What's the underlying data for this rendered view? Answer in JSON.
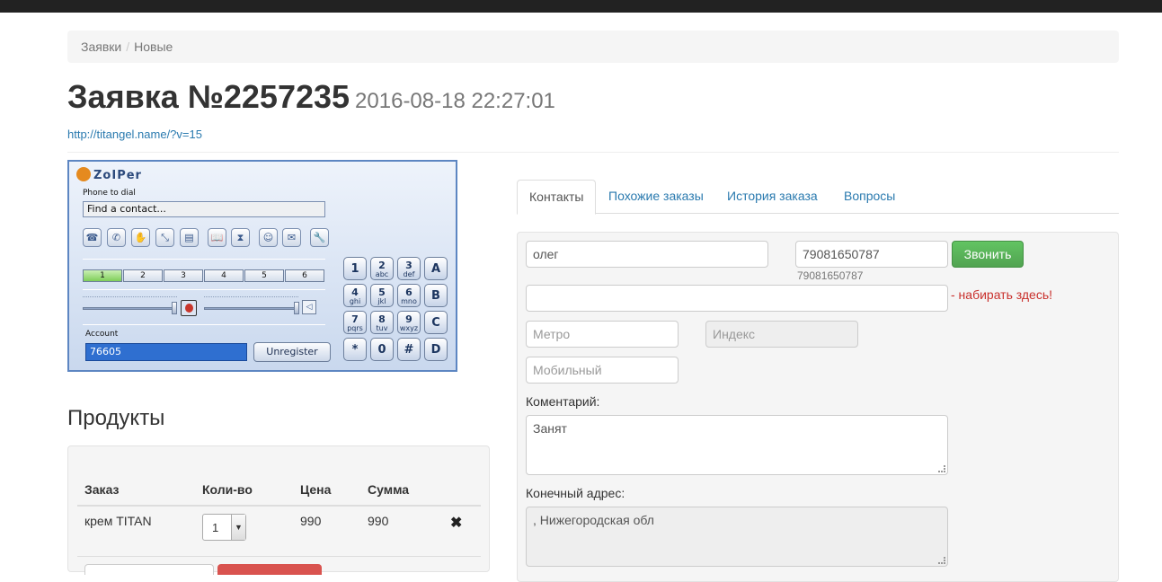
{
  "breadcrumb": {
    "items": [
      "Заявки",
      "Новые"
    ]
  },
  "page": {
    "title": "Заявка №2257235",
    "datetime": "2016-08-18 22:27:01",
    "source_link": "http://titangel.name/?v=15"
  },
  "zoiper": {
    "logo": "ZoIPer",
    "phone_to_dial_label": "Phone to dial",
    "find_placeholder": "Find a contact...",
    "tool_icons": [
      "hangup-icon",
      "call-icon",
      "hold-icon",
      "transfer-icon",
      "notes-icon",
      "contacts-book-icon",
      "history-icon",
      "conference-icon",
      "messages-icon",
      "settings-icon"
    ],
    "lines": [
      "1",
      "2",
      "3",
      "4",
      "5",
      "6"
    ],
    "active_line": "1",
    "account_label": "Account",
    "account_value": "76605",
    "unregister_label": "Unregister",
    "keypad": [
      {
        "digit": "1",
        "letters": ""
      },
      {
        "digit": "2",
        "letters": "abc"
      },
      {
        "digit": "3",
        "letters": "def"
      },
      {
        "digit": "A",
        "letters": ""
      },
      {
        "digit": "4",
        "letters": "ghi"
      },
      {
        "digit": "5",
        "letters": "jkl"
      },
      {
        "digit": "6",
        "letters": "mno"
      },
      {
        "digit": "B",
        "letters": ""
      },
      {
        "digit": "7",
        "letters": "pqrs"
      },
      {
        "digit": "8",
        "letters": "tuv"
      },
      {
        "digit": "9",
        "letters": "wxyz"
      },
      {
        "digit": "C",
        "letters": ""
      },
      {
        "digit": "*",
        "letters": ""
      },
      {
        "digit": "0",
        "letters": ""
      },
      {
        "digit": "#",
        "letters": ""
      },
      {
        "digit": "D",
        "letters": ""
      }
    ]
  },
  "products": {
    "title": "Продукты",
    "headers": [
      "Заказ",
      "Коли-во",
      "Цена",
      "Сумма"
    ],
    "rows": [
      {
        "name": "крем TITAN",
        "qty": "1",
        "price": "990",
        "sum": "990"
      }
    ],
    "remove_icon": "✖"
  },
  "tabs": [
    "Контакты",
    "Похожие заказы",
    "История заказа",
    "Вопросы"
  ],
  "active_tab": "Контакты",
  "contact": {
    "name_value": "олег",
    "phone_value": "79081650787",
    "phone_hint": "79081650787",
    "call_button": "Звонить",
    "dial_value": "",
    "dial_hint": "- набирать здесь!",
    "metro_placeholder": "Метро",
    "index_placeholder": "Индекс",
    "mobile_placeholder": "Мобильный",
    "comment_label": "Коментарий:",
    "comment_value": "Занят",
    "address_label": "Конечный адрес:",
    "address_value": ", Нижегородская обл"
  },
  "colors": {
    "link": "#2a7aaf",
    "call_button": "#5bb75b",
    "hint_red": "#c9302c",
    "zoiper_border": "#5d86c2",
    "zoiper_account_bg": "#2f6fd0"
  }
}
